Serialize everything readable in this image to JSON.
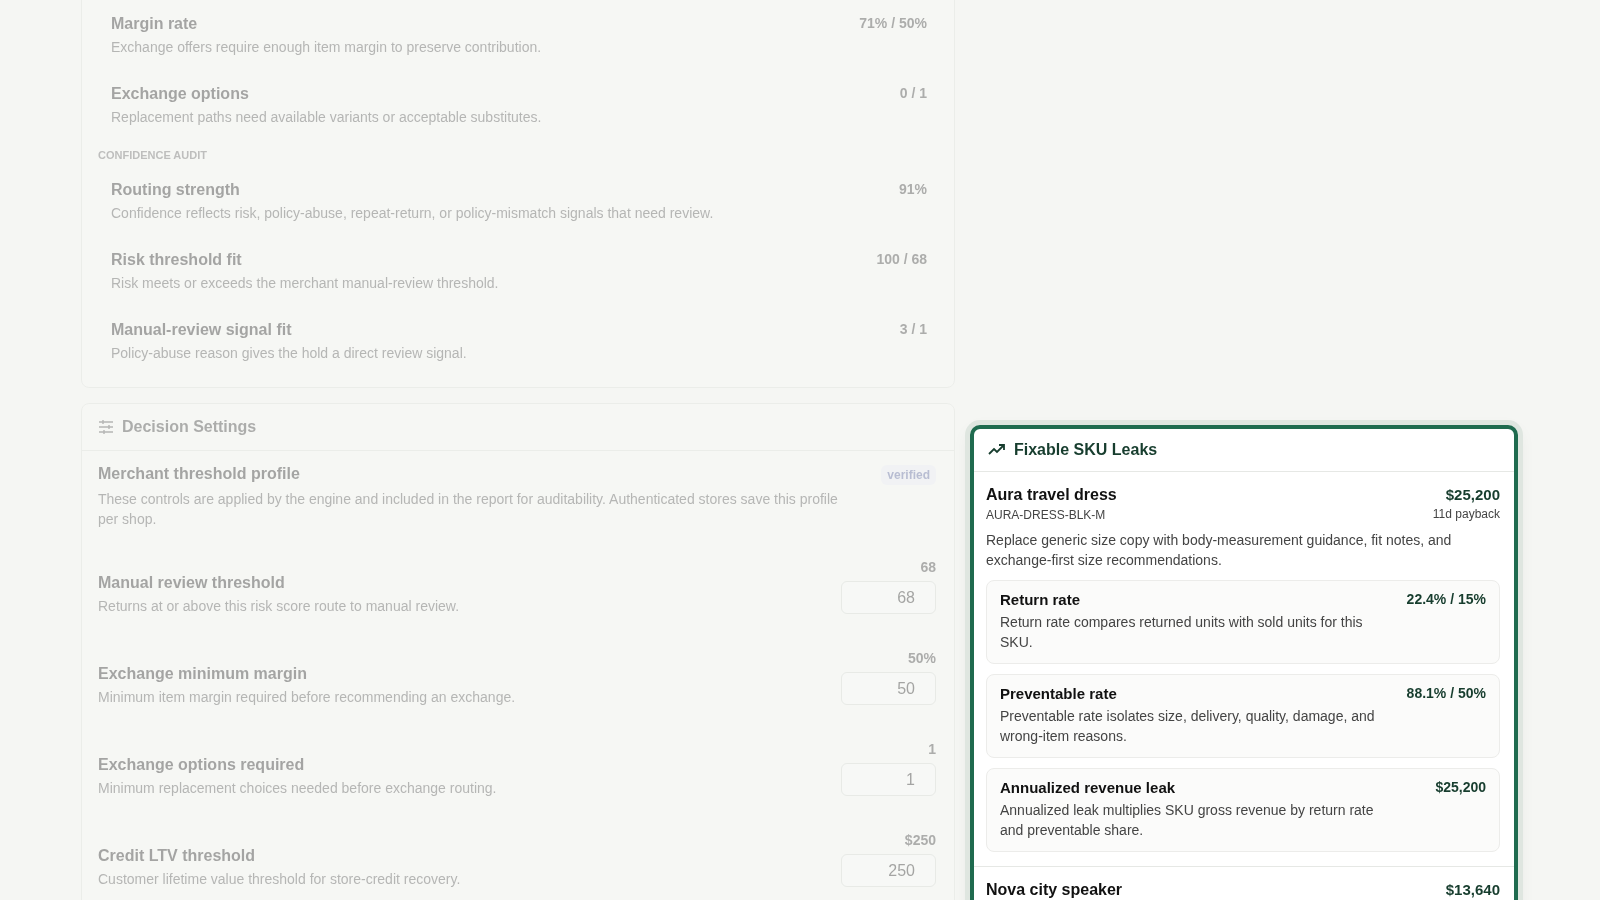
{
  "audit": {
    "rows": [
      {
        "title": "Margin rate",
        "description": "Exchange offers require enough item margin to preserve contribution.",
        "value": "71% / 50%"
      },
      {
        "title": "Exchange options",
        "description": "Replacement paths need available variants or acceptable substitutes.",
        "value": "0 / 1"
      }
    ],
    "confidence_audit": {
      "heading": "CONFIDENCE AUDIT",
      "rows": [
        {
          "title": "Routing strength",
          "description": "Confidence reflects risk, policy-abuse, repeat-return, or policy-mismatch signals that need review.",
          "value": "91%"
        },
        {
          "title": "Risk threshold fit",
          "description": "Risk meets or exceeds the merchant manual-review threshold.",
          "value": "100 / 68"
        },
        {
          "title": "Manual-review signal fit",
          "description": "Policy-abuse reason gives the hold a direct review signal.",
          "value": "3 / 1"
        }
      ]
    }
  },
  "decision_settings": {
    "title": "Decision Settings",
    "profile": {
      "title": "Merchant threshold profile",
      "badge": "verified",
      "description": "These controls are applied by the engine and included in the report for auditability. Authenticated stores save this profile per shop."
    },
    "fields": [
      {
        "title": "Manual review threshold",
        "description": "Returns at or above this risk score route to manual review.",
        "reading": "68",
        "value": "68"
      },
      {
        "title": "Exchange minimum margin",
        "description": "Minimum item margin required before recommending an exchange.",
        "reading": "50%",
        "value": "50"
      },
      {
        "title": "Exchange options required",
        "description": "Minimum replacement choices needed before exchange routing.",
        "reading": "1",
        "value": "1"
      },
      {
        "title": "Credit LTV threshold",
        "description": "Customer lifetime value threshold for store-credit recovery.",
        "reading": "$250",
        "value": "250"
      }
    ]
  },
  "sku_leaks": {
    "title": "Fixable SKU Leaks",
    "items": [
      {
        "name": "Aura travel dress",
        "sku": "AURA-DRESS-BLK-M",
        "amount": "$25,200",
        "payback": "11d payback",
        "description": "Replace generic size copy with body-measurement guidance, fit notes, and exchange-first size recommendations.",
        "metrics": [
          {
            "title": "Return rate",
            "value": "22.4% / 15%",
            "description": "Return rate compares returned units with sold units for this SKU."
          },
          {
            "title": "Preventable rate",
            "value": "88.1% / 50%",
            "description": "Preventable rate isolates size, delivery, quality, damage, and wrong-item reasons."
          },
          {
            "title": "Annualized revenue leak",
            "value": "$25,200",
            "description": "Annualized leak multiplies SKU gross revenue by return rate and preventable share."
          }
        ]
      },
      {
        "name": "Nova city speaker",
        "amount": "$13,640"
      }
    ]
  }
}
